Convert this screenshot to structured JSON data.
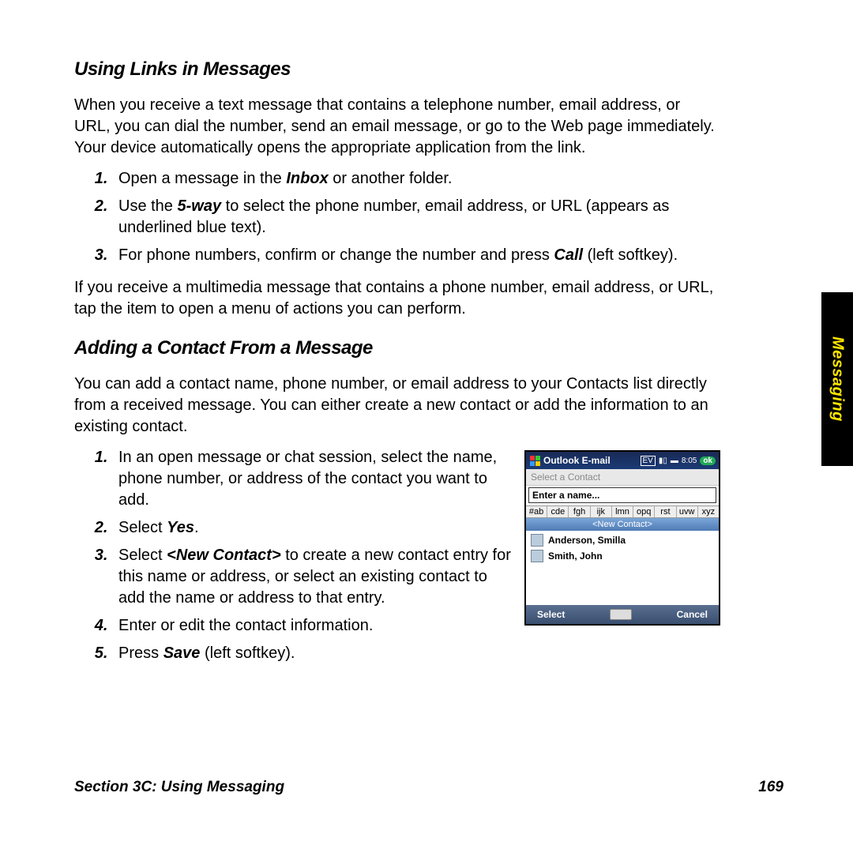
{
  "sideTab": "Messaging",
  "footer": {
    "section": "Section 3C: Using Messaging",
    "page": "169"
  },
  "h1": "Using Links in Messages",
  "p1": "When you receive a text message that contains a telephone number, email address, or URL, you can dial the number, send an email message, or go to the Web page immediately. Your device automatically opens the appropriate application from the link.",
  "list1": {
    "s1a": "Open a message in the ",
    "s1b": "Inbox",
    "s1c": " or another folder.",
    "s2a": "Use the ",
    "s2b": "5-way",
    "s2c": " to select the phone number, email address, or URL (appears as underlined blue text).",
    "s3a": "For phone numbers, confirm or change the number and press ",
    "s3b": "Call",
    "s3c": " (left softkey)."
  },
  "p2": "If you receive a multimedia message that contains a phone number, email address, or URL, tap the item to open a menu of actions you can perform.",
  "h2": "Adding a Contact From a Message",
  "p3": "You can add a contact name, phone number, or email address to your Contacts list directly from a received message. You can either create a new contact or add the information to an existing contact.",
  "list2": {
    "s1": "In an open message or chat session, select the name, phone number, or address of the contact you want to add.",
    "s2a": "Select ",
    "s2b": "Yes",
    "s2c": ".",
    "s3a": "Select ",
    "s3b": "<New Contact>",
    "s3c": " to create a new contact entry for this name or address, or select an existing contact to add the name or address to that entry.",
    "s4": "Enter or edit the contact information.",
    "s5a": "Press ",
    "s5b": "Save",
    "s5c": " (left softkey)."
  },
  "phone": {
    "title": "Outlook E-mail",
    "ev": "EV",
    "time": "8:05",
    "ok": "ok",
    "sub": "Select a Contact",
    "search": "Enter a name...",
    "alpha": [
      "#ab",
      "cde",
      "fgh",
      "ijk",
      "lmn",
      "opq",
      "rst",
      "uvw",
      "xyz"
    ],
    "newcontact": "<New Contact>",
    "contacts": [
      "Anderson, Smilla",
      "Smith, John"
    ],
    "leftSoft": "Select",
    "rightSoft": "Cancel"
  }
}
